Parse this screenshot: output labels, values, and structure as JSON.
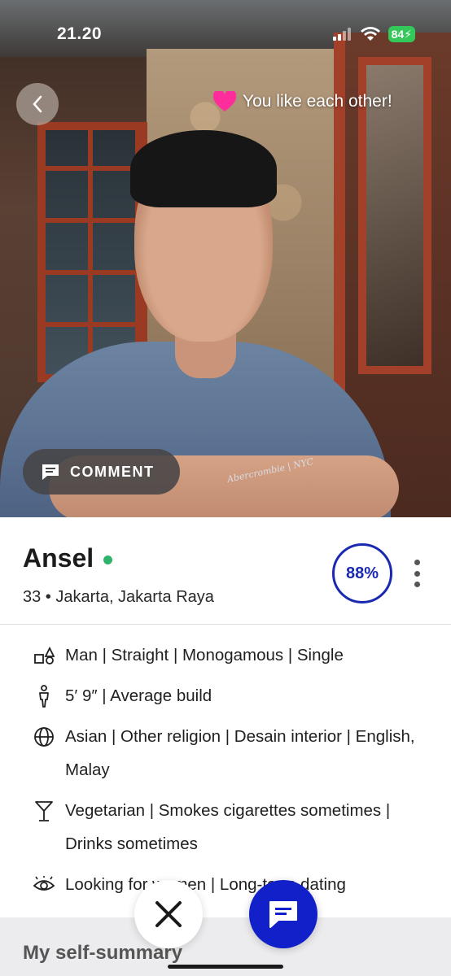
{
  "status_bar": {
    "time": "21.20",
    "battery": "84"
  },
  "photo": {
    "mutual_like_text": "You like each other!",
    "comment_label": "COMMENT",
    "shirt_text": "Abercrombie | NYC"
  },
  "profile": {
    "name": "Ansel",
    "online": true,
    "meta": "33 • Jakarta, Jakarta Raya",
    "match_percent": "88%"
  },
  "details": [
    {
      "icon": "gender-icon",
      "text": "Man | Straight | Monogamous | Single"
    },
    {
      "icon": "body-icon",
      "text": "5′ 9″ | Average build"
    },
    {
      "icon": "globe-icon",
      "text": "Asian | Other religion | Desain interior | English, Malay"
    },
    {
      "icon": "cocktail-icon",
      "text": "Vegetarian | Smokes cigarettes sometimes | Drinks sometimes"
    },
    {
      "icon": "eye-icon",
      "text": "Looking for women | Long-term dating"
    }
  ],
  "summary": {
    "title": "My self-summary"
  },
  "colors": {
    "accent": "#1120c8",
    "online": "#2fb36c",
    "battery": "#34c759"
  }
}
